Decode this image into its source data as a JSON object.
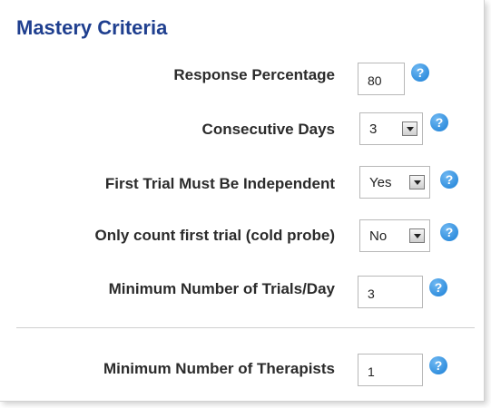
{
  "title": "Mastery Criteria",
  "fields": {
    "response_percentage": {
      "label": "Response Percentage",
      "value": "80"
    },
    "consecutive_days": {
      "label": "Consecutive Days",
      "value": "3"
    },
    "first_trial_independent": {
      "label": "First Trial Must Be Independent",
      "value": "Yes"
    },
    "only_count_first_trial": {
      "label": "Only count first trial (cold probe)",
      "value": "No"
    },
    "min_trials_per_day": {
      "label": "Minimum Number of Trials/Day",
      "value": "3"
    },
    "min_therapists": {
      "label": "Minimum Number of Therapists",
      "value": "1"
    }
  },
  "help_glyph": "?",
  "icons": {
    "help": "question-mark-circle",
    "dropdown": "chevron-down"
  },
  "colors": {
    "title": "#1f3f8f",
    "help_icon": "#1a7fd6"
  }
}
